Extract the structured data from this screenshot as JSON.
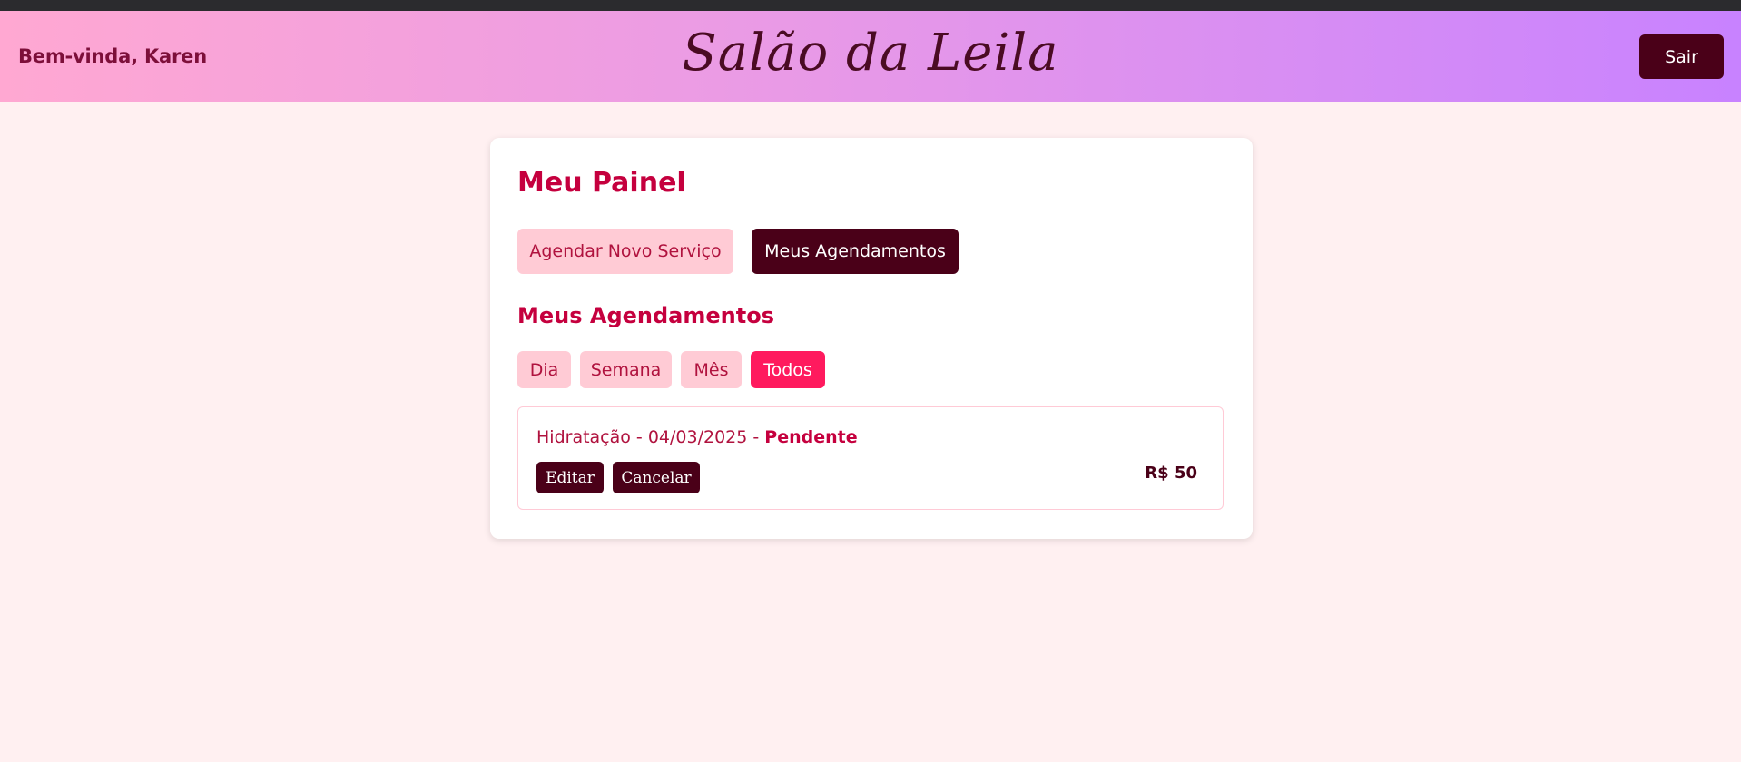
{
  "header": {
    "greeting": "Bem-vinda, Karen",
    "brand": "Salão da Leila",
    "logout_label": "Sair"
  },
  "panel": {
    "title": "Meu Painel",
    "tabs": [
      {
        "label": "Agendar Novo Serviço",
        "active": false
      },
      {
        "label": "Meus Agendamentos",
        "active": true
      }
    ],
    "section_title": "Meus Agendamentos",
    "filters": [
      {
        "label": "Dia",
        "active": false
      },
      {
        "label": "Semana",
        "active": false
      },
      {
        "label": "Mês",
        "active": false
      },
      {
        "label": "Todos",
        "active": true
      }
    ],
    "appointments": [
      {
        "service": "Hidratação",
        "separator": " - ",
        "date": "04/03/2025",
        "status": "Pendente",
        "price": "R$ 50",
        "edit_label": "Editar",
        "cancel_label": "Cancelar"
      }
    ]
  },
  "colors": {
    "page_background": "#fff0f1",
    "header_gradient_start": "#ffa8d2",
    "header_gradient_end": "#c882ff",
    "accent_dark": "#4a0018",
    "accent_red": "#c5003e",
    "filter_active": "#ff1a5e",
    "tab_inactive": "#ffcbd5"
  }
}
